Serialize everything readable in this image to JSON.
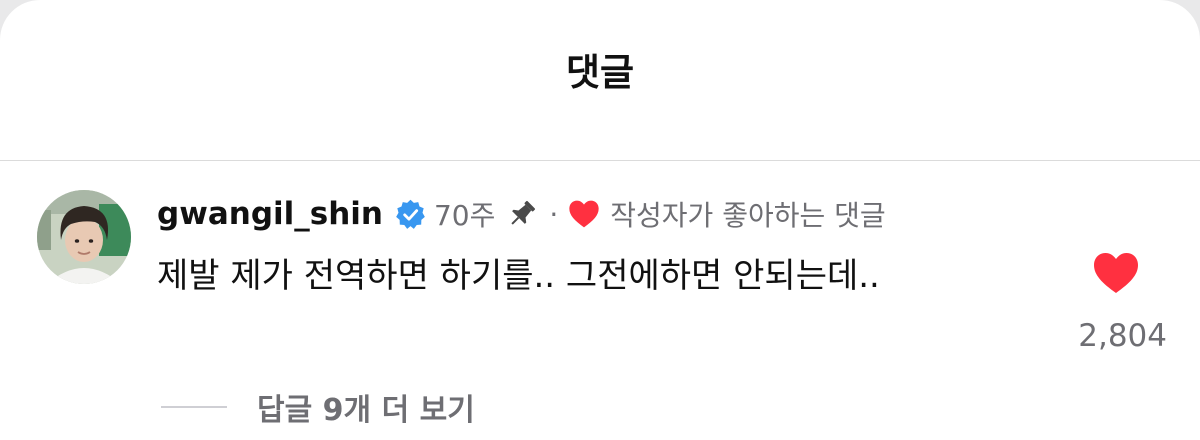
{
  "header": {
    "title": "댓글"
  },
  "comment": {
    "username": "gwangil_shin",
    "verified_icon": "verified-badge-icon",
    "time": "70주",
    "pin_icon": "pin-icon",
    "separator": "·",
    "author_liked_label": "작성자가 좋아하는 댓글",
    "text": "제발 제가 전역하면 하기를.. 그전에하면 안되는데..",
    "like_count": "2,804",
    "replies_label": "답글 9개 더 보기"
  },
  "colors": {
    "heart": "#ff3040",
    "verified": "#3897f0",
    "secondary_text": "#6e6e73",
    "primary_text": "#111111"
  }
}
